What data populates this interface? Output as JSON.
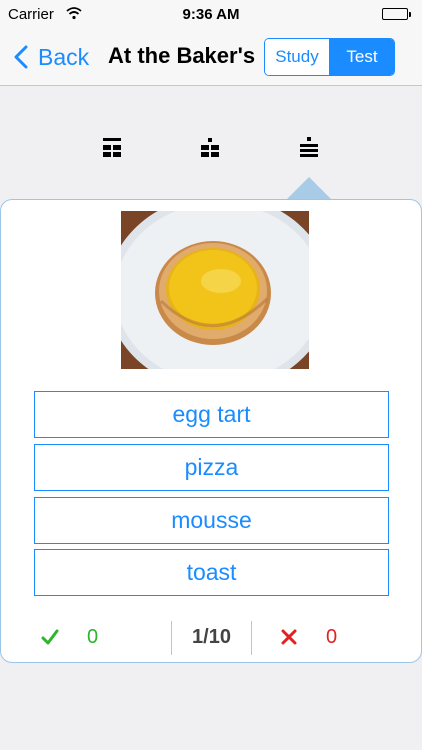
{
  "status_bar": {
    "carrier": "Carrier",
    "time": "9:36 AM",
    "icons": [
      "wifi-icon",
      "battery-icon"
    ]
  },
  "nav": {
    "back_label": "Back",
    "title": "At the Baker's",
    "segments": {
      "study": "Study",
      "test": "Test",
      "selected": "Test"
    }
  },
  "modes": {
    "icons": [
      "grid-icon-1",
      "grid-icon-2",
      "grid-icon-3"
    ],
    "selected_index": 2
  },
  "quiz": {
    "image": "egg-tart-photo",
    "answers": [
      "egg tart",
      "pizza",
      "mousse",
      "toast"
    ]
  },
  "score": {
    "correct": "0",
    "progress": "1/10",
    "wrong": "0"
  },
  "colors": {
    "accent": "#1a8cff",
    "correct": "#2db52d",
    "wrong": "#e22222"
  }
}
